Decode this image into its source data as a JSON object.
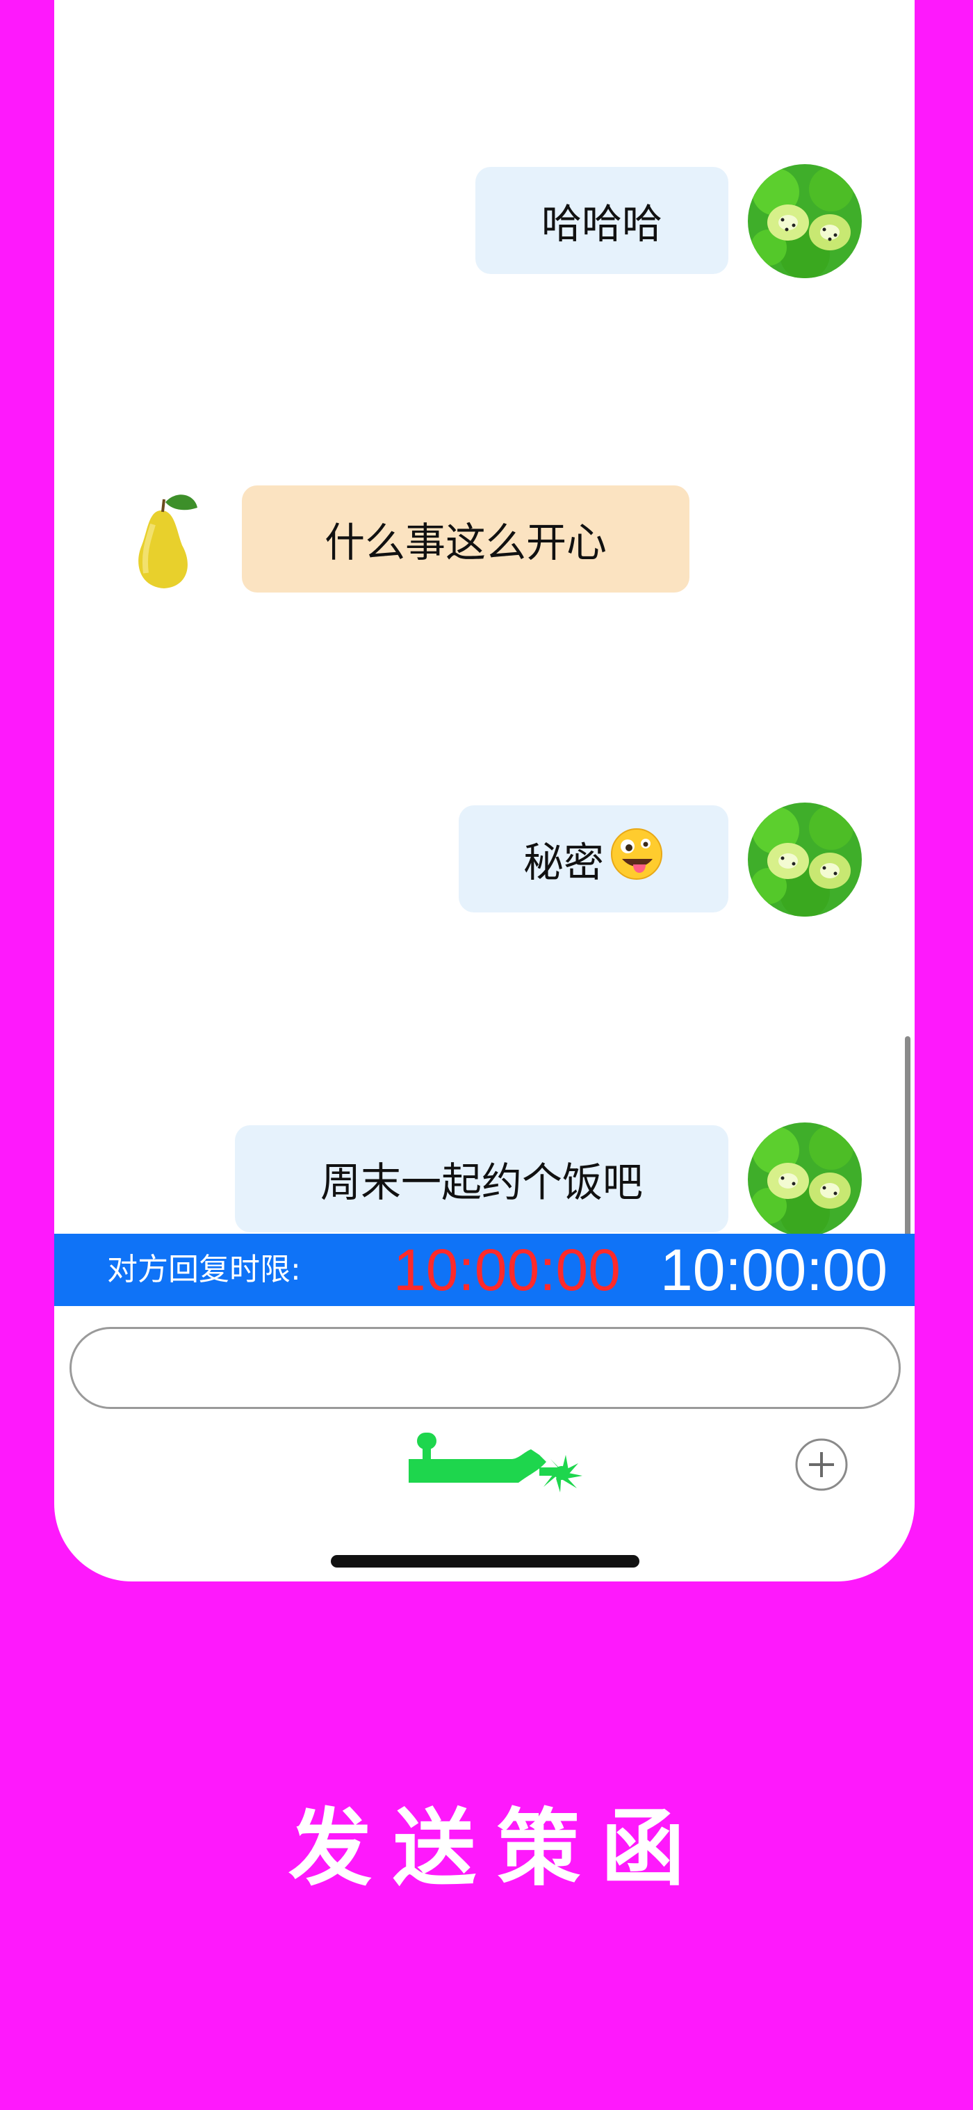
{
  "messages": [
    {
      "sender": "me",
      "avatar": "kiwi-avatar",
      "text": "哈哈哈"
    },
    {
      "sender": "other",
      "avatar": "pear-avatar",
      "text": "什么事这么开心"
    },
    {
      "sender": "me",
      "avatar": "kiwi-avatar",
      "text": "秘密",
      "emoji": "zany-face-emoji"
    },
    {
      "sender": "me",
      "avatar": "kiwi-avatar",
      "text": "周末一起约个饭吧"
    }
  ],
  "timer": {
    "label": "对方回复时限:",
    "countdown_red": "10:00:00",
    "countdown_white": "10:00:00"
  },
  "input": {
    "value": "",
    "placeholder": ""
  },
  "toolbar": {
    "spur_icon": "spur-icon",
    "add_icon": "plus-circle-icon"
  },
  "caption": "发送策函",
  "colors": {
    "background": "#fe19fc",
    "bubble_me": "#e6f2fc",
    "bubble_other": "#fbe3c1",
    "timer_bar": "#0f73f7",
    "timer_red": "#ff2a2a",
    "spur_green": "#1ed64d"
  }
}
